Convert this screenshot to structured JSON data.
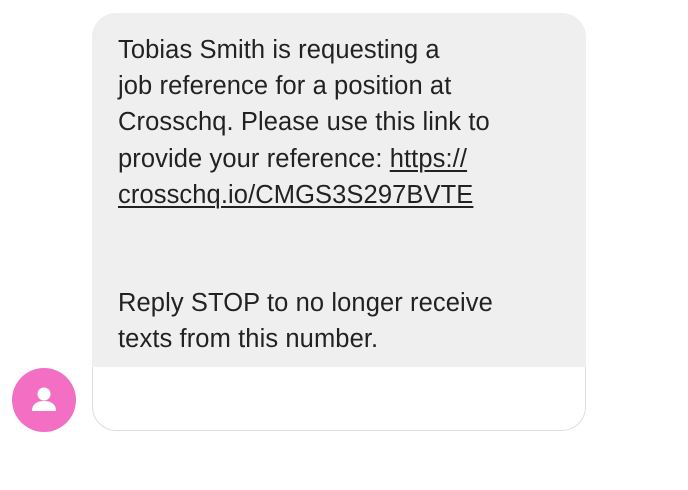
{
  "message": {
    "line1": "Tobias Smith is requesting a",
    "line2": "job reference for a position at",
    "line3": "Crosschq. Please use this link to",
    "line4_prefix": "provide your reference: ",
    "link_part1": "https://",
    "link_part2": "crosschq.io/CMGS3S297BVTE",
    "stop_line1": "Reply STOP to no longer receive",
    "stop_line2": "texts from this number."
  },
  "sender": {
    "avatar_icon": "person-icon",
    "avatar_color": "#f26fc3"
  },
  "colors": {
    "bubble_background": "#efefef",
    "text": "#222222"
  }
}
